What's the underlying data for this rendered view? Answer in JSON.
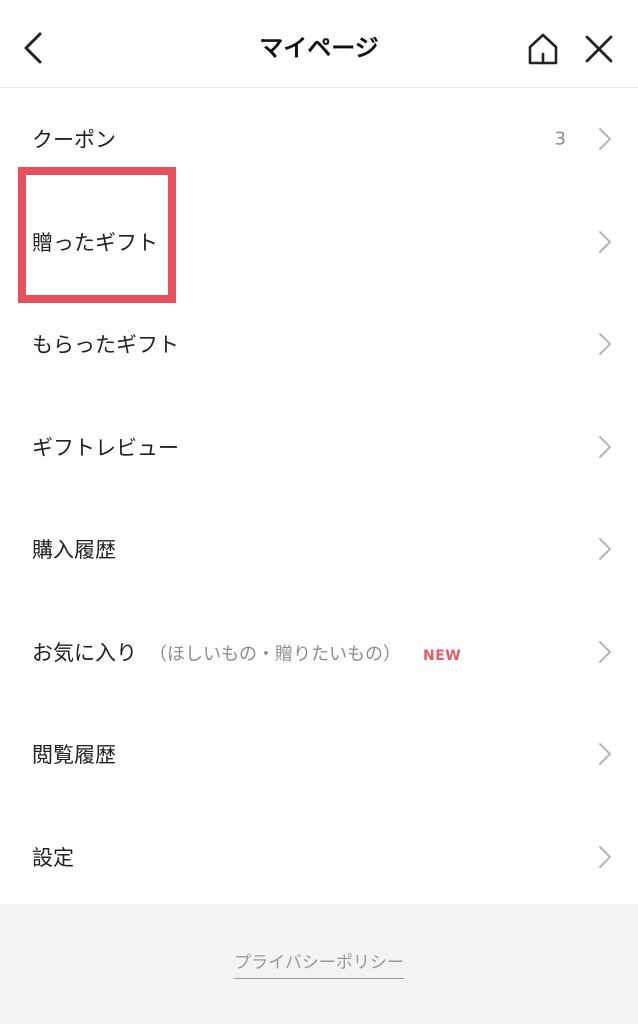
{
  "header": {
    "title": "マイページ",
    "back_icon": "chevron-left-icon",
    "home_icon": "home-icon",
    "close_icon": "close-icon"
  },
  "menu": {
    "items": [
      {
        "label": "クーポン",
        "count": "3"
      },
      {
        "label": "贈ったギフト",
        "highlighted": true
      },
      {
        "label": "もらったギフト"
      },
      {
        "label": "ギフトレビュー"
      },
      {
        "label": "購入履歴"
      },
      {
        "label": "お気に入り",
        "sub": "（ほしいもの・贈りたいもの）",
        "badge": "NEW"
      },
      {
        "label": "閲覧履歴"
      },
      {
        "label": "設定"
      }
    ]
  },
  "footer": {
    "privacy_label": "プライバシーポリシー"
  },
  "colors": {
    "highlight": "#e8505b",
    "badge_new": "#e85a68",
    "footer_bg": "#f2f3f5",
    "muted_text": "#8e8e8e"
  }
}
